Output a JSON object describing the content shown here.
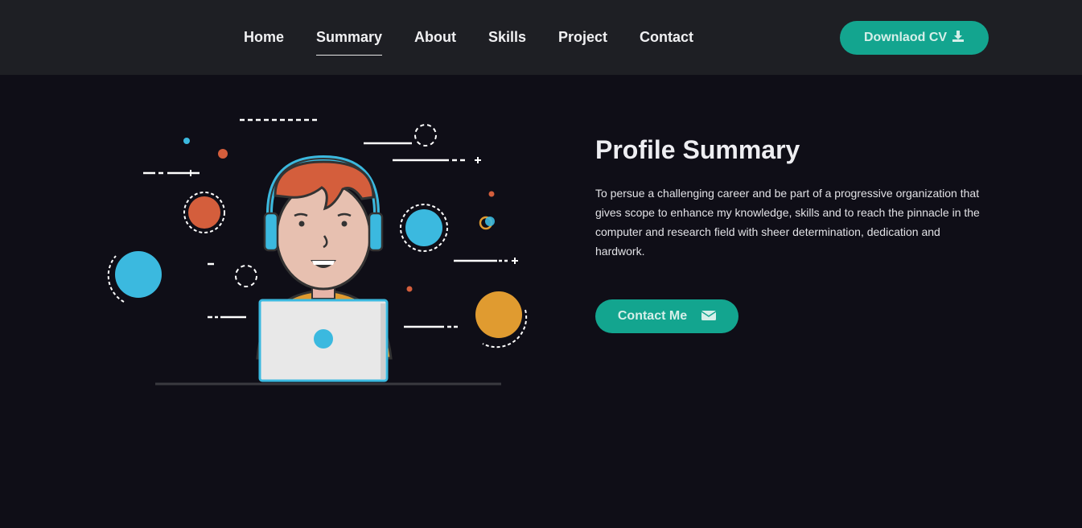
{
  "nav": {
    "items": [
      {
        "label": "Home",
        "active": false
      },
      {
        "label": "Summary",
        "active": true
      },
      {
        "label": "About",
        "active": false
      },
      {
        "label": "Skills",
        "active": false
      },
      {
        "label": "Project",
        "active": false
      },
      {
        "label": "Contact",
        "active": false
      }
    ],
    "cv_button": {
      "label": "Downlaod CV",
      "icon": "download-icon"
    }
  },
  "summary": {
    "title": "Profile Summary",
    "text": "To persue a challenging career and be part of a progressive organization that gives scope to enhance my knowledge, skills and to reach the pinnacle in the computer and research field with sheer determination, dedication and hardwork.",
    "contact_button": {
      "label": "Contact Me",
      "icon": "envelope-icon"
    }
  },
  "colors": {
    "background": "#0f0e17",
    "navbar": "#1e1f24",
    "accent": "#13a58f",
    "blue": "#3bb9df",
    "orange": "#d45e3c",
    "yellow": "#e09b30"
  }
}
